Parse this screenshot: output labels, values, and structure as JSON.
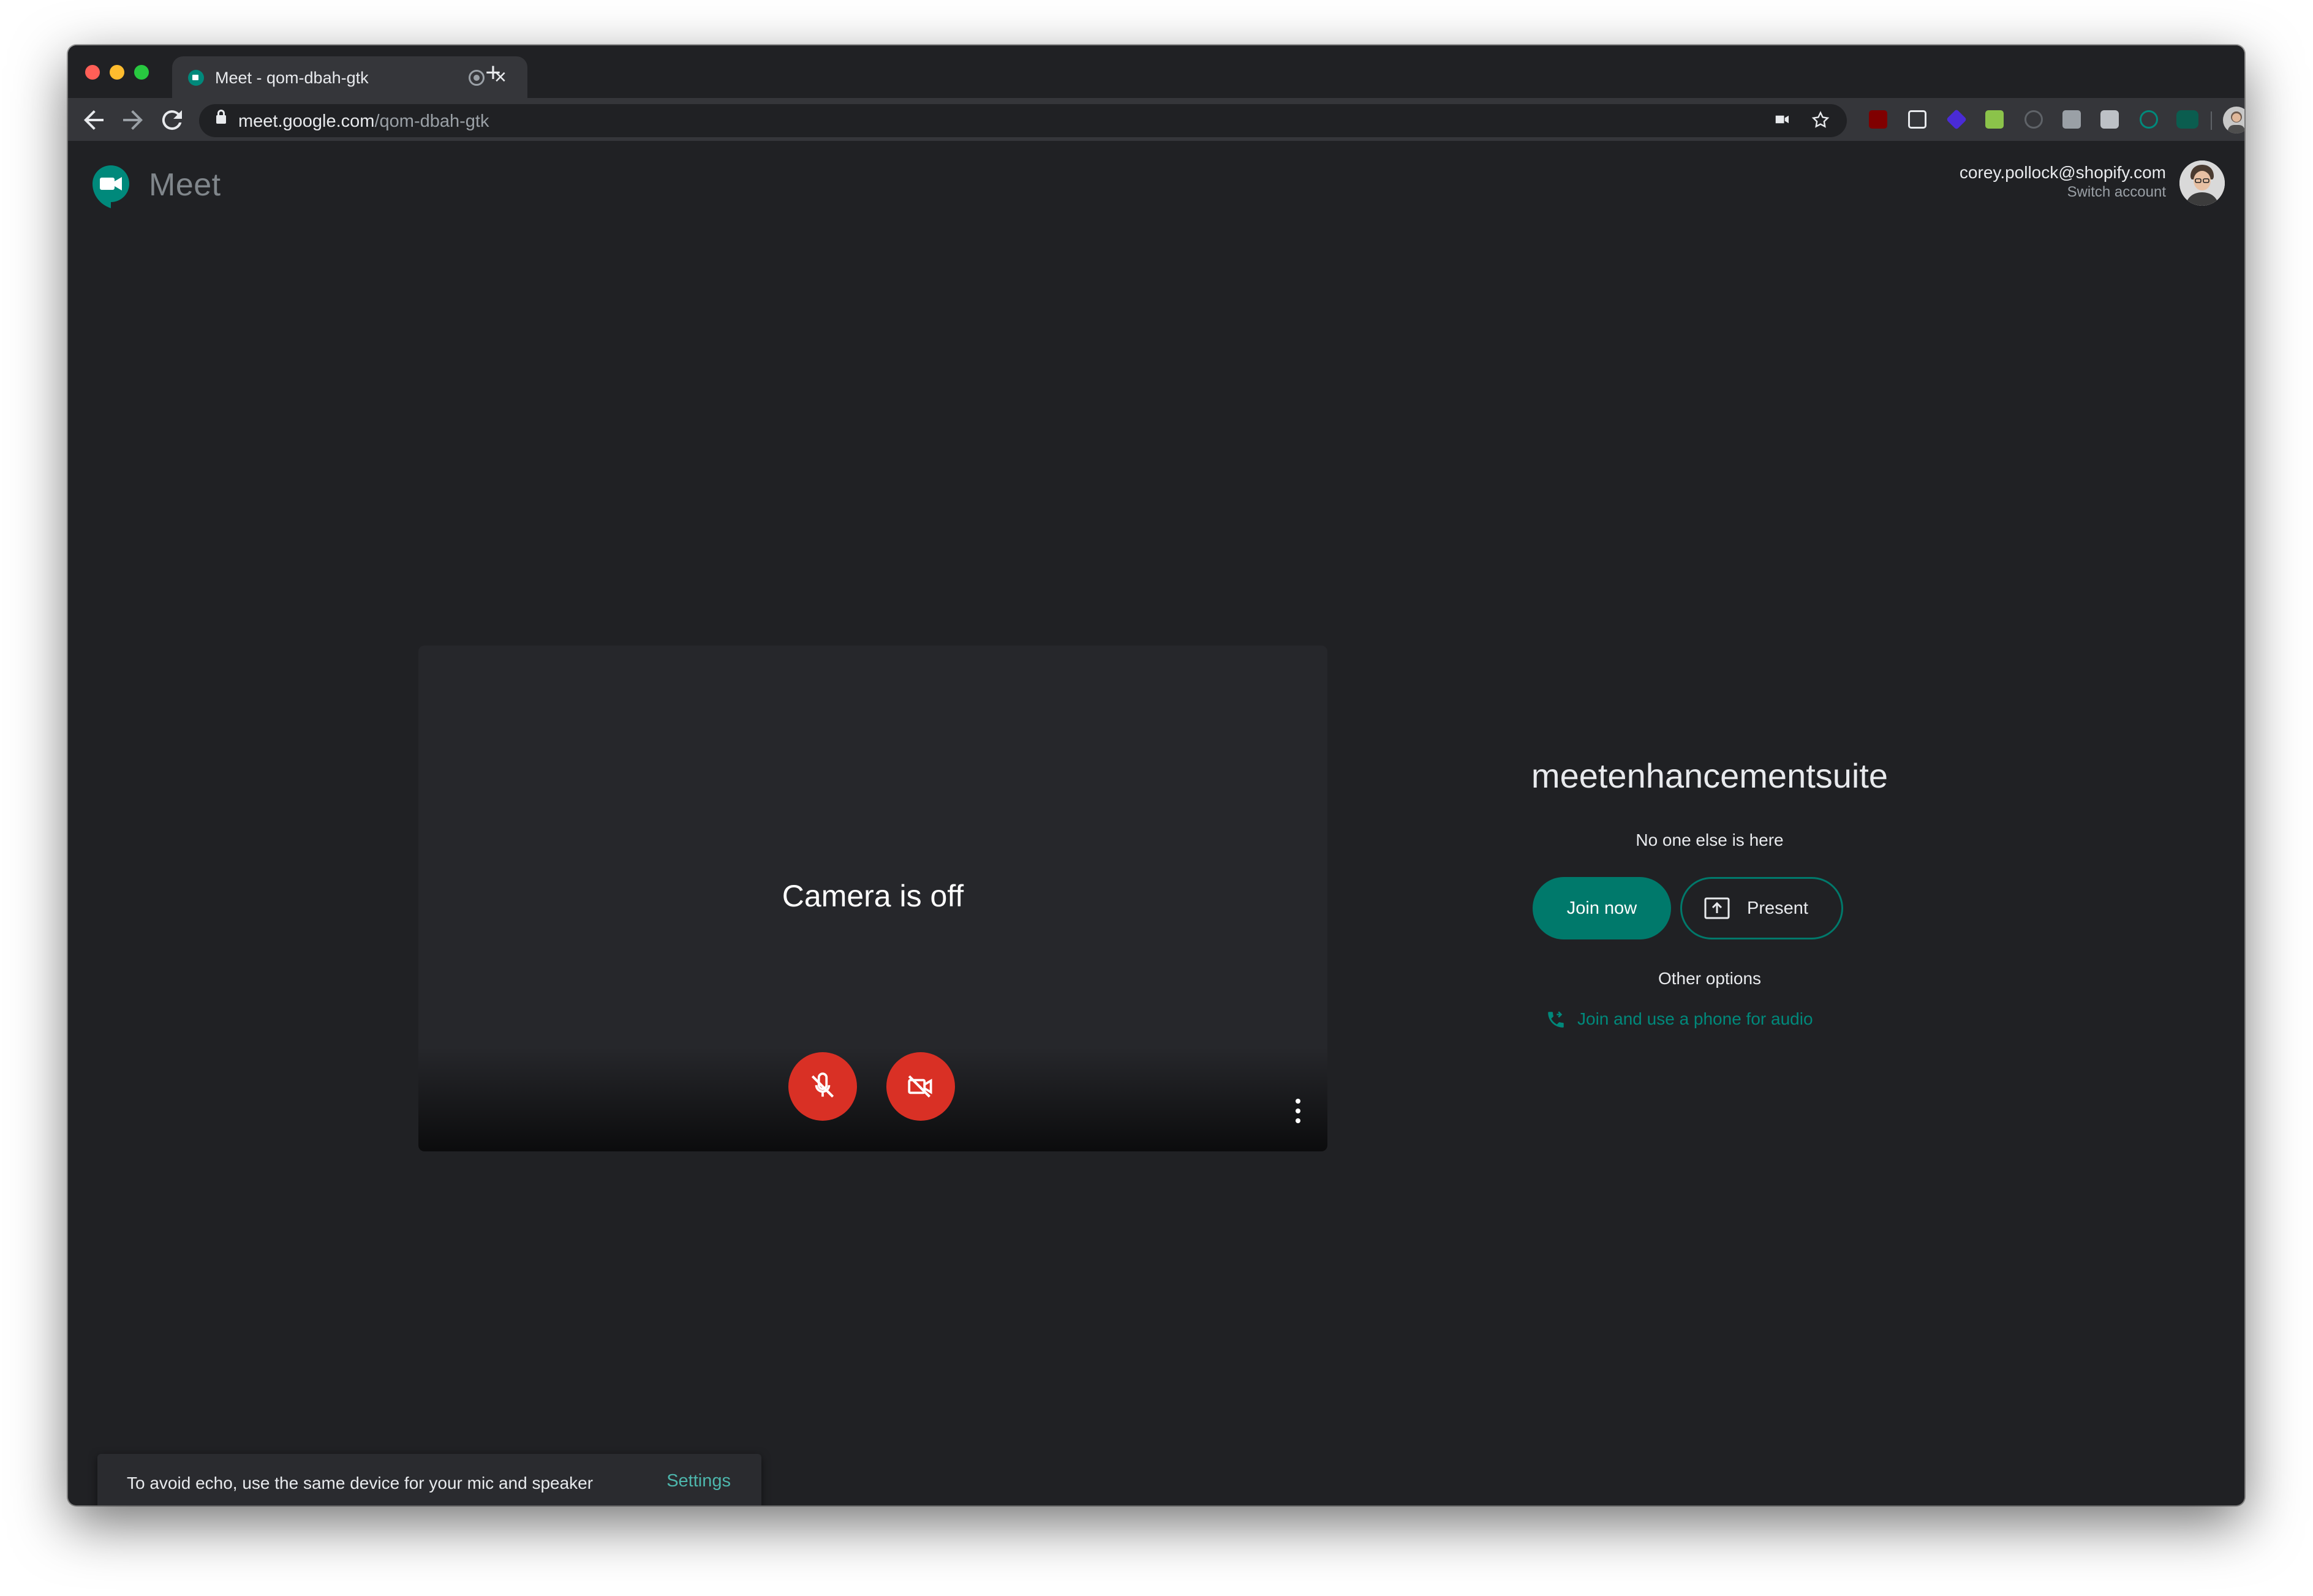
{
  "browser": {
    "tab_title": "Meet - qom-dbah-gtk",
    "new_tab_label": "+",
    "url_host": "meet.google.com",
    "url_path": "/qom-dbah-gtk"
  },
  "header": {
    "app_name": "Meet",
    "account_email": "corey.pollock@shopify.com",
    "switch_account": "Switch account"
  },
  "preview": {
    "camera_status": "Camera is off",
    "mic_muted": true,
    "camera_muted": true
  },
  "meeting": {
    "name": "meetenhancementsuite",
    "status": "No one else is here",
    "join_label": "Join now",
    "present_label": "Present",
    "other_options": "Other options",
    "phone_audio_label": "Join and use a phone for audio"
  },
  "snackbar": {
    "message": "To avoid echo, use the same device for your mic and speaker",
    "action": "Settings"
  },
  "colors": {
    "background": "#202124",
    "accent": "#00796b",
    "danger": "#d93025",
    "link": "#00897b"
  }
}
